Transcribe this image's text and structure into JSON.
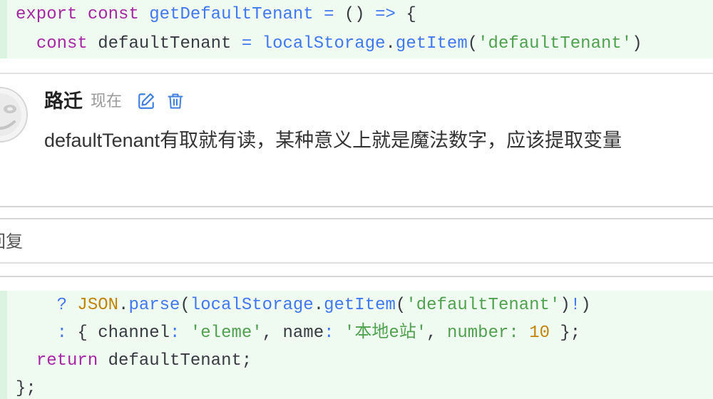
{
  "colors": {
    "accent": "#3f7fe0",
    "diff_added_bg": "#effbf1",
    "diff_added_gutter": "#dcf3e1"
  },
  "diff_top": {
    "lines": [
      {
        "tokens": [
          {
            "text": "export",
            "color": "#a626a4"
          },
          {
            "text": " ",
            "color": "#383a42"
          },
          {
            "text": "const",
            "color": "#a626a4"
          },
          {
            "text": " ",
            "color": "#383a42"
          },
          {
            "text": "getDefaultTenant",
            "color": "#4078f2"
          },
          {
            "text": " ",
            "color": "#383a42"
          },
          {
            "text": "=",
            "color": "#4078f2"
          },
          {
            "text": " () ",
            "color": "#383a42"
          },
          {
            "text": "=>",
            "color": "#4078f2"
          },
          {
            "text": " {",
            "color": "#383a42"
          }
        ]
      },
      {
        "tokens": [
          {
            "text": "  ",
            "color": "#383a42"
          },
          {
            "text": "const",
            "color": "#a626a4"
          },
          {
            "text": " defaultTenant ",
            "color": "#383a42"
          },
          {
            "text": "=",
            "color": "#4078f2"
          },
          {
            "text": " ",
            "color": "#383a42"
          },
          {
            "text": "localStorage",
            "color": "#4078f2"
          },
          {
            "text": ".",
            "color": "#383a42"
          },
          {
            "text": "getItem",
            "color": "#4078f2"
          },
          {
            "text": "(",
            "color": "#383a42"
          },
          {
            "text": "'defaultTenant'",
            "color": "#50a14f"
          },
          {
            "text": ")",
            "color": "#383a42"
          }
        ]
      }
    ]
  },
  "comment": {
    "avatar_icon": "smiley-avatar-icon",
    "author": "路迁",
    "time": "现在",
    "edit_icon": "edit-icon",
    "delete_icon": "trash-icon",
    "body": "defaultTenant有取就有读，某种意义上就是魔法数字，应该提取变量"
  },
  "reply": {
    "label": "回复"
  },
  "diff_bottom": {
    "lines": [
      {
        "tokens": [
          {
            "text": "    ",
            "color": "#383a42"
          },
          {
            "text": "?",
            "color": "#4078f2"
          },
          {
            "text": " ",
            "color": "#383a42"
          },
          {
            "text": "JSON",
            "color": "#c18401"
          },
          {
            "text": ".",
            "color": "#383a42"
          },
          {
            "text": "parse",
            "color": "#4078f2"
          },
          {
            "text": "(",
            "color": "#383a42"
          },
          {
            "text": "localStorage",
            "color": "#4078f2"
          },
          {
            "text": ".",
            "color": "#383a42"
          },
          {
            "text": "getItem",
            "color": "#4078f2"
          },
          {
            "text": "(",
            "color": "#383a42"
          },
          {
            "text": "'defaultTenant'",
            "color": "#50a14f"
          },
          {
            "text": ")",
            "color": "#383a42"
          },
          {
            "text": "!",
            "color": "#4078f2"
          },
          {
            "text": ")",
            "color": "#383a42"
          }
        ]
      },
      {
        "tokens": [
          {
            "text": "    ",
            "color": "#383a42"
          },
          {
            "text": ":",
            "color": "#4078f2"
          },
          {
            "text": " { channel",
            "color": "#383a42"
          },
          {
            "text": ":",
            "color": "#4078f2"
          },
          {
            "text": " ",
            "color": "#383a42"
          },
          {
            "text": "'eleme'",
            "color": "#50a14f"
          },
          {
            "text": ", name",
            "color": "#383a42"
          },
          {
            "text": ":",
            "color": "#4078f2"
          },
          {
            "text": " ",
            "color": "#383a42"
          },
          {
            "text": "'本地e站'",
            "color": "#50a14f"
          },
          {
            "text": ", ",
            "color": "#383a42"
          },
          {
            "text": "number:",
            "color": "#50a14f"
          },
          {
            "text": " ",
            "color": "#383a42"
          },
          {
            "text": "10",
            "color": "#c18401"
          },
          {
            "text": " };",
            "color": "#383a42"
          }
        ]
      },
      {
        "tokens": [
          {
            "text": "  ",
            "color": "#383a42"
          },
          {
            "text": "return",
            "color": "#a626a4"
          },
          {
            "text": " defaultTenant;",
            "color": "#383a42"
          }
        ]
      },
      {
        "tokens": [
          {
            "text": "};",
            "color": "#383a42"
          }
        ]
      }
    ]
  }
}
